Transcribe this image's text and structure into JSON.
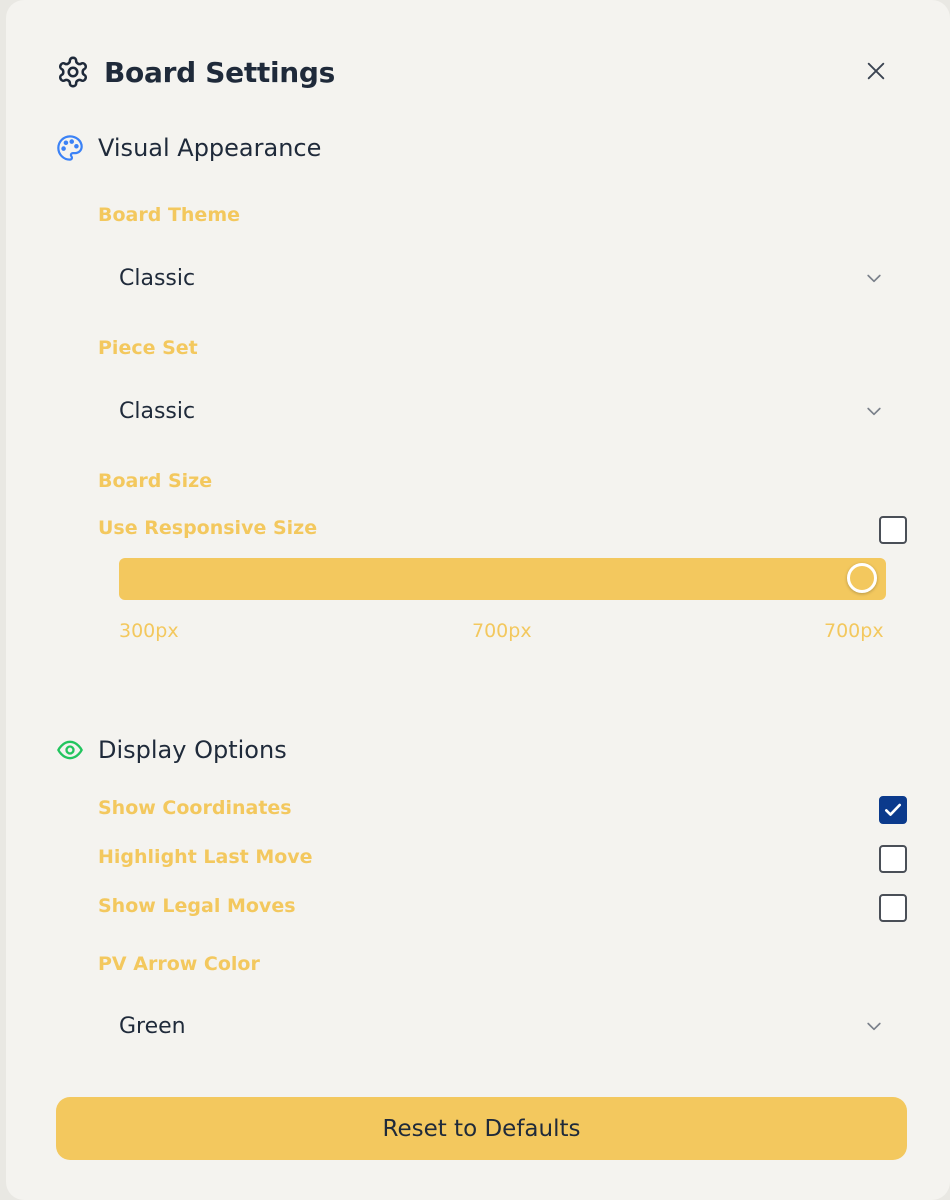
{
  "header": {
    "title": "Board Settings",
    "icon": "gear-icon",
    "close_icon": "close-icon"
  },
  "visual_appearance": {
    "title": "Visual Appearance",
    "icon": "palette-icon",
    "icon_color": "#3b82f6",
    "board_theme": {
      "label": "Board Theme",
      "value": "Classic"
    },
    "piece_set": {
      "label": "Piece Set",
      "value": "Classic"
    },
    "board_size": {
      "label": "Board Size",
      "responsive_label": "Use Responsive Size",
      "responsive_checked": false,
      "slider": {
        "min_label": "300px",
        "current_label": "700px",
        "max_label": "700px",
        "min": 300,
        "max": 700,
        "value": 700
      }
    }
  },
  "display_options": {
    "title": "Display Options",
    "icon": "eye-icon",
    "icon_color": "#22c55e",
    "options": [
      {
        "label": "Show Coordinates",
        "checked": true
      },
      {
        "label": "Highlight Last Move",
        "checked": false
      },
      {
        "label": "Show Legal Moves",
        "checked": false
      }
    ],
    "pv_arrow": {
      "label": "PV Arrow Color",
      "value": "Green"
    }
  },
  "reset_label": "Reset to Defaults",
  "colors": {
    "accent": "#f3c85e",
    "checkbox_checked": "#0b3a8c",
    "text": "#1f2a3a",
    "panel": "#f4f3ef"
  }
}
